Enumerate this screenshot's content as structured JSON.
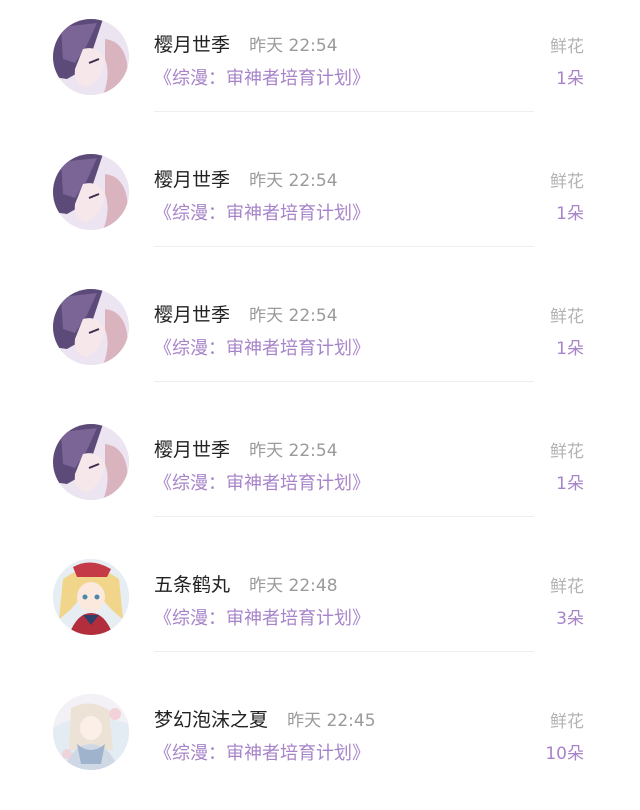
{
  "records": [
    {
      "username": "樱月世季",
      "time": "昨天 22:54",
      "book": "《综漫：审神者培育计划》",
      "gift_label": "鲜花",
      "gift_count": "1朵",
      "avatar": "avatar-purple-hair"
    },
    {
      "username": "樱月世季",
      "time": "昨天 22:54",
      "book": "《综漫：审神者培育计划》",
      "gift_label": "鲜花",
      "gift_count": "1朵",
      "avatar": "avatar-purple-hair"
    },
    {
      "username": "樱月世季",
      "time": "昨天 22:54",
      "book": "《综漫：审神者培育计划》",
      "gift_label": "鲜花",
      "gift_count": "1朵",
      "avatar": "avatar-purple-hair"
    },
    {
      "username": "樱月世季",
      "time": "昨天 22:54",
      "book": "《综漫：审神者培育计划》",
      "gift_label": "鲜花",
      "gift_count": "1朵",
      "avatar": "avatar-purple-hair"
    },
    {
      "username": "五条鹤丸",
      "time": "昨天 22:48",
      "book": "《综漫：审神者培育计划》",
      "gift_label": "鲜花",
      "gift_count": "3朵",
      "avatar": "avatar-blonde-girl"
    },
    {
      "username": "梦幻泡沫之夏",
      "time": "昨天 22:45",
      "book": "《综漫：审神者培育计划》",
      "gift_label": "鲜花",
      "gift_count": "10朵",
      "avatar": "avatar-pale-illustration"
    }
  ],
  "colors": {
    "accent": "#a784c9",
    "name": "#222222",
    "muted": "#9a9a9a"
  }
}
